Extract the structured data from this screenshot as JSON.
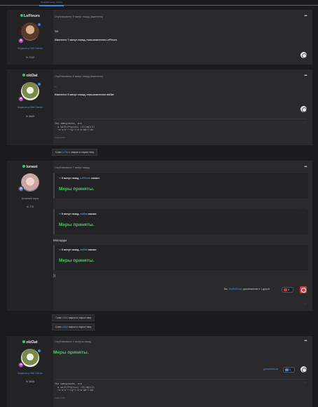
{
  "tab": {
    "label": "Неправильные ответы"
  },
  "post1": {
    "username": "LeFleurs",
    "group": "Модератор Wei Games",
    "count": "7242",
    "meta": "Опубликовано: 8 минут назад (изменено)",
    "text": "SM",
    "edited": "Изменено 7 минут назад, пользователем LeFleurs"
  },
  "post2": {
    "username": "old3at",
    "group": "Модератор Wei Games",
    "count": "3609",
    "meta": "Опубликовано: 8 минут назад (изменено)",
    "text": "...",
    "edited": "Изменено 6 минут назад, пользователем old3at",
    "sig": "The immigrants, are\n  a ta(5)f*g(nic) (3)(nb)(2)\n  ~u~s~e~~~ny~l~e~a~ab~l~ae\n",
    "sig_small": "Award 2009"
  },
  "sys1": {
    "prefix": "6 мин",
    "user": "LeFleurs",
    "action": "закрыл и открыл тему"
  },
  "post3": {
    "username": "lunast",
    "group": "Активный игрок",
    "count": "772",
    "meta": "Опубликовано: 7 минут назад",
    "q1_head_pre": "8 минут назад,",
    "q1_user": "LeFleurs",
    "q1_head_post": "сказал:",
    "q1_body": "Меры приняты.",
    "q2_head_pre": "8 минут назад,",
    "q2_user": "old3at",
    "q2_head_post": "сказал:",
    "q2_body": "Меры приняты.",
    "mid_text": "Молодцы",
    "q3_head_pre": "8 минут назад,",
    "q3_user": "old3at",
    "q3_head_post": "сказал:",
    "q3_body": "Меры приняты.",
    "tail_text": "))",
    "reacted_prefix": "Вы,",
    "reacted_users": "TheRedDead",
    "reacted_suffix": ", gmcwinsrender и 1 другой",
    "react_count": "3",
    "sig_small": "..."
  },
  "sys2": {
    "prefix": "7 мин",
    "user": "old3at",
    "action": "закрыл и открыл тему"
  },
  "sys3": {
    "prefix": "6 мин",
    "user": "old3at",
    "action": "закрыл и открыл тему"
  },
  "post4": {
    "username": "old3at",
    "group": "Модератор Wei Games",
    "count": "3609",
    "meta": "Опубликовано: 4 минуты назад",
    "body": "Меры приняты.",
    "react_user": "gmcwinsrender",
    "react_count": "1",
    "sig": "The immigrants, are\n  a ta(5)f*g(nic) (3)(nb)(2)\n  ~u~s~e~~~ny~l~e~a~ab~l~ae\n",
    "sig_small": "Award 2009"
  },
  "colors": {
    "accent": "#3a8be0",
    "green": "#3ecf63",
    "online": "#2ecc71",
    "like_red": "#d9363e"
  }
}
